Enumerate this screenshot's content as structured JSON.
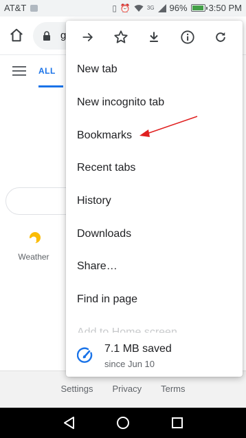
{
  "status_bar": {
    "carrier": "AT&T",
    "network": "3G",
    "battery": "96%",
    "time": "3:50 PM"
  },
  "toolbar": {
    "url_fragment": "g"
  },
  "page": {
    "tab_all": "ALL",
    "weather_label": "Weather"
  },
  "menu": {
    "items": [
      {
        "label": "New tab"
      },
      {
        "label": "New incognito tab"
      },
      {
        "label": "Bookmarks"
      },
      {
        "label": "Recent tabs"
      },
      {
        "label": "History"
      },
      {
        "label": "Downloads"
      },
      {
        "label": "Share…"
      },
      {
        "label": "Find in page"
      },
      {
        "label": "Add to Home screen"
      }
    ],
    "data_saver": {
      "title": "7.1 MB saved",
      "subtitle": "since Jun 10"
    }
  },
  "footer": {
    "settings": "Settings",
    "privacy": "Privacy",
    "terms": "Terms"
  },
  "colors": {
    "accent": "#1a73e8",
    "annotation_arrow": "#e02020"
  }
}
